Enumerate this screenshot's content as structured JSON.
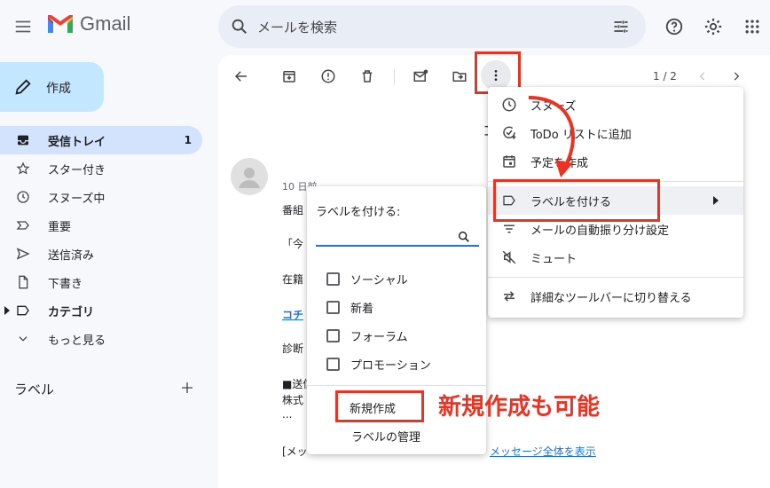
{
  "app": {
    "name": "Gmail"
  },
  "search": {
    "placeholder": "メールを検索"
  },
  "compose": {
    "label": "作成"
  },
  "sidebar": {
    "items": [
      {
        "label": "受信トレイ",
        "count": "1"
      },
      {
        "label": "スター付き"
      },
      {
        "label": "スヌーズ中"
      },
      {
        "label": "重要"
      },
      {
        "label": "送信済み"
      },
      {
        "label": "下書き"
      },
      {
        "label": "カテゴリ"
      },
      {
        "label": "もっと見る"
      }
    ],
    "labels_heading": "ラベル"
  },
  "toolbar": {
    "pager": "1 / 2"
  },
  "email": {
    "date_fragment": "10 日前",
    "line1": "番組",
    "line2": "「今",
    "line3": "在籍",
    "link1": "コチ",
    "line4": "診断",
    "line5": "■送信",
    "line6": "株式",
    "line7": "...",
    "line8": "[メッ",
    "link_full": "メッセージ全体を表示",
    "subject_fragment": "コ"
  },
  "label_popup": {
    "title": "ラベルを付ける:",
    "input_value": "",
    "options": [
      "ソーシャル",
      "新着",
      "フォーラム",
      "プロモーション"
    ],
    "new_label": "新規作成",
    "manage": "ラベルの管理"
  },
  "more_menu": {
    "items": [
      {
        "label": "スヌーズ",
        "icon": "clock-icon"
      },
      {
        "label": "ToDo リストに追加",
        "icon": "add-task-icon"
      },
      {
        "label": "予定を作成",
        "icon": "calendar-icon"
      },
      {
        "label": "ラベルを付ける",
        "icon": "label-icon"
      },
      {
        "label": "メールの自動振り分け設定",
        "icon": "filter-icon"
      },
      {
        "label": "ミュート",
        "icon": "mute-icon"
      },
      {
        "label": "詳細なツールバーに切り替える",
        "icon": "swap-icon"
      }
    ]
  },
  "annotation": {
    "callout": "新規作成も可能"
  },
  "colors": {
    "accent": "#ea3323",
    "active_nav": "#d3e3fd",
    "compose_bg": "#c2e7ff",
    "link": "#1a73e8"
  }
}
